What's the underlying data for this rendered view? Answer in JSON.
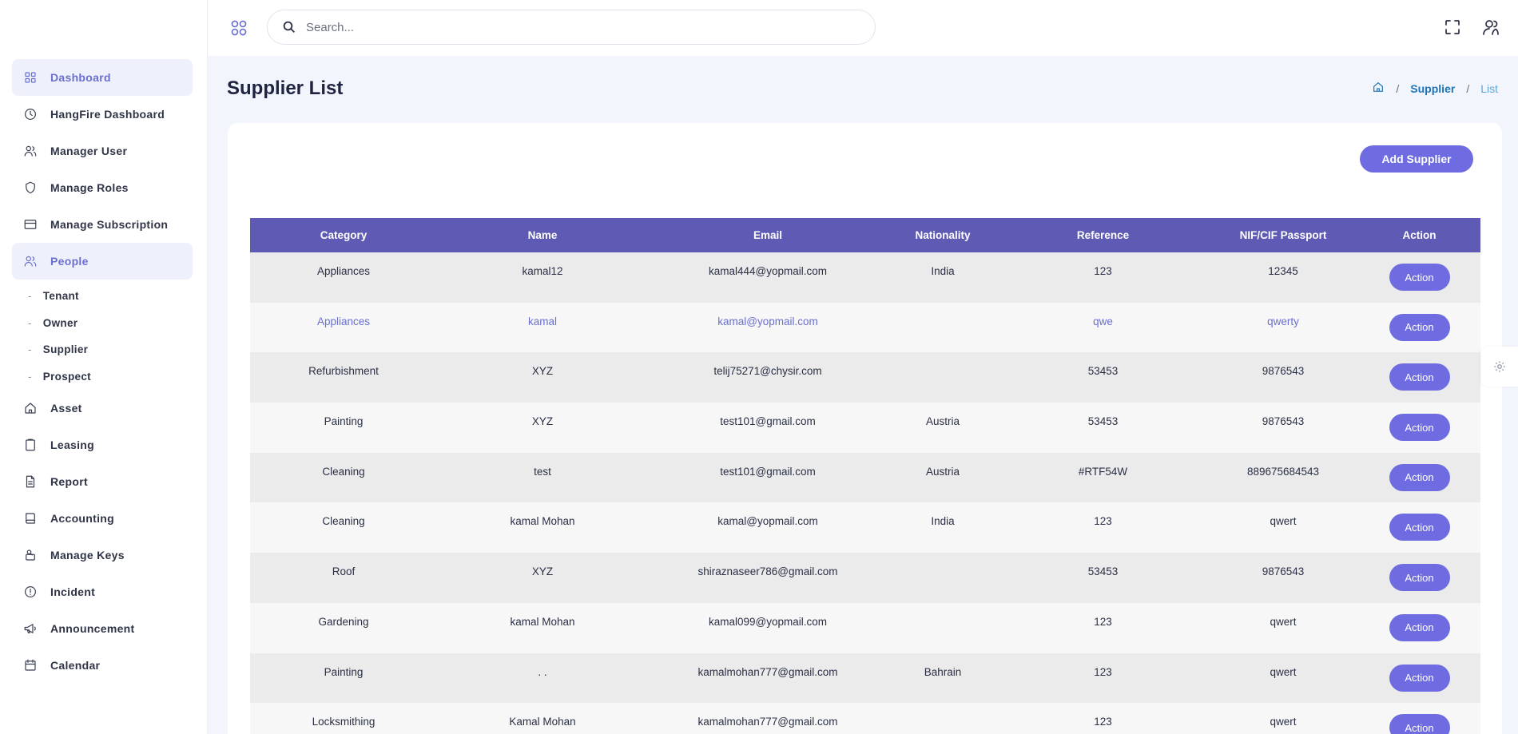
{
  "sidebar": {
    "items": [
      {
        "label": "Dashboard",
        "icon": "grid-icon"
      },
      {
        "label": "HangFire Dashboard",
        "icon": "clock-icon"
      },
      {
        "label": "Manager User",
        "icon": "users-icon"
      },
      {
        "label": "Manage Roles",
        "icon": "shield-icon"
      },
      {
        "label": "Manage Subscription",
        "icon": "credit-card-icon"
      },
      {
        "label": "People",
        "icon": "people-icon"
      }
    ],
    "people_sub": [
      "Tenant",
      "Owner",
      "Supplier",
      "Prospect"
    ],
    "items_after": [
      {
        "label": "Asset",
        "icon": "home-icon"
      },
      {
        "label": "Leasing",
        "icon": "clipboard-icon"
      },
      {
        "label": "Report",
        "icon": "file-icon"
      },
      {
        "label": "Accounting",
        "icon": "book-icon"
      },
      {
        "label": "Manage Keys",
        "icon": "key-icon"
      },
      {
        "label": "Incident",
        "icon": "alert-icon"
      },
      {
        "label": "Announcement",
        "icon": "megaphone-icon"
      },
      {
        "label": "Calendar",
        "icon": "calendar-icon"
      }
    ]
  },
  "search": {
    "placeholder": "Search..."
  },
  "page": {
    "title": "Supplier List"
  },
  "breadcrumb": {
    "items": [
      "Supplier",
      "List"
    ]
  },
  "add_button": "Add Supplier",
  "table": {
    "headers": [
      "Category",
      "Name",
      "Email",
      "Nationality",
      "Reference",
      "NIF/CIF Passport",
      "Action"
    ],
    "action_label": "Action",
    "rows": [
      [
        "Appliances",
        "kamal12",
        "kamal444@yopmail.com",
        "India",
        "123",
        "12345"
      ],
      [
        "Appliances",
        "kamal",
        "kamal@yopmail.com",
        "",
        "qwe",
        "qwerty"
      ],
      [
        "Refurbishment",
        "XYZ",
        "telij75271@chysir.com",
        "",
        "53453",
        "9876543"
      ],
      [
        "Painting",
        "XYZ",
        "test101@gmail.com",
        "Austria",
        "53453",
        "9876543"
      ],
      [
        "Cleaning",
        "test",
        "test101@gmail.com",
        "Austria",
        "#RTF54W",
        "889675684543"
      ],
      [
        "Cleaning",
        "kamal Mohan",
        "kamal@yopmail.com",
        "India",
        "123",
        "qwert"
      ],
      [
        "Roof",
        "XYZ",
        "shiraznaseer786@gmail.com",
        "",
        "53453",
        "9876543"
      ],
      [
        "Gardening",
        "kamal Mohan",
        "kamal099@yopmail.com",
        "",
        "123",
        "qwert"
      ],
      [
        "Painting",
        ". .",
        "kamalmohan777@gmail.com",
        "Bahrain",
        "123",
        "qwert"
      ],
      [
        "Locksmithing",
        "Kamal Mohan",
        "kamalmohan777@gmail.com",
        "",
        "123",
        "qwert"
      ]
    ]
  },
  "colors": {
    "accent": "#6e6ce0",
    "header": "#5f5bb5",
    "link": "#1d75b8"
  }
}
